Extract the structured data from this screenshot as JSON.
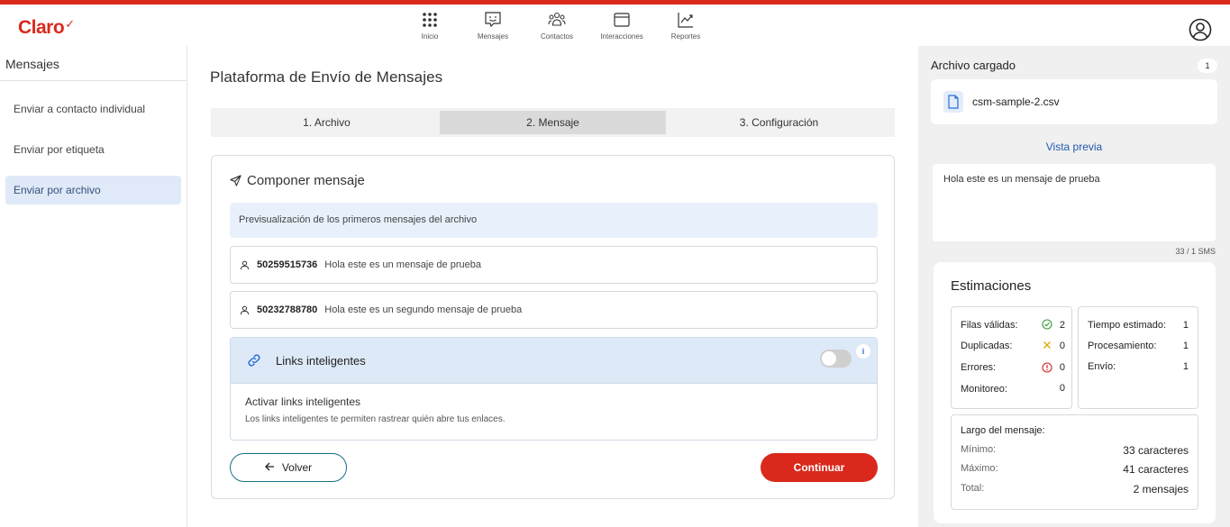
{
  "brand": {
    "logo": "Claro",
    "accent": "#da291c"
  },
  "nav": [
    {
      "label": "Inicio",
      "icon": "grid-icon"
    },
    {
      "label": "Mensajes",
      "icon": "message-icon"
    },
    {
      "label": "Contactos",
      "icon": "contacts-icon"
    },
    {
      "label": "Interacciones",
      "icon": "window-icon"
    },
    {
      "label": "Reportes",
      "icon": "chart-icon"
    }
  ],
  "sidebar": {
    "title": "Mensajes",
    "items": [
      {
        "label": "Enviar a contacto individual",
        "active": false
      },
      {
        "label": "Enviar por etiqueta",
        "active": false
      },
      {
        "label": "Enviar por archivo",
        "active": true
      }
    ]
  },
  "main": {
    "title": "Plataforma de Envío de Mensajes",
    "steps": [
      {
        "label": "1. Archivo",
        "active": false
      },
      {
        "label": "2. Mensaje",
        "active": true
      },
      {
        "label": "3. Configuración",
        "active": false
      }
    ],
    "compose": {
      "title": "Componer mensaje",
      "info": "Previsualización de los primeros mensajes del archivo",
      "messages": [
        {
          "number": "50259515736",
          "text": "Hola este es un mensaje de prueba"
        },
        {
          "number": "50232788780",
          "text": "Hola este es un segundo mensaje de prueba"
        }
      ],
      "smart_links": {
        "title": "Links inteligentes",
        "info_icon": "i",
        "enabled": false,
        "activate_label": "Activar links inteligentes",
        "description": "Los links inteligentes te permiten rastrear quién abre tus enlaces."
      },
      "back_label": "Volver",
      "continue_label": "Continuar"
    }
  },
  "right_panel": {
    "title": "Archivo cargado",
    "count": "1",
    "file_name": "csm-sample-2.csv",
    "preview_link": "Vista previa",
    "preview_text": "Hola este es un mensaje de prueba",
    "sms_count": "33 / 1 SMS",
    "estimations": {
      "title": "Estimaciones",
      "rows_left": [
        {
          "label": "Filas válidas:",
          "value": "2",
          "icon": "check-circle-icon",
          "color": "#3a9a3a"
        },
        {
          "label": "Duplicadas:",
          "value": "0",
          "icon": "x-icon",
          "color": "#e0a800"
        },
        {
          "label": "Errores:",
          "value": "0",
          "icon": "alert-circle-icon",
          "color": "#d02020"
        },
        {
          "label": "Monitoreo:",
          "value": "0",
          "icon": "",
          "color": ""
        }
      ],
      "rows_right": [
        {
          "label": "Tiempo estimado:",
          "value": "1"
        },
        {
          "label": "Procesamiento:",
          "value": "1"
        },
        {
          "label": "Envío:",
          "value": "1"
        }
      ],
      "length": {
        "title": "Largo del mensaje:",
        "rows": [
          {
            "label": "Mínimo:",
            "value": "33 caracteres"
          },
          {
            "label": "Máximo:",
            "value": "41 caracteres"
          },
          {
            "label": "Total:",
            "value": "2 mensajes"
          }
        ]
      }
    }
  }
}
